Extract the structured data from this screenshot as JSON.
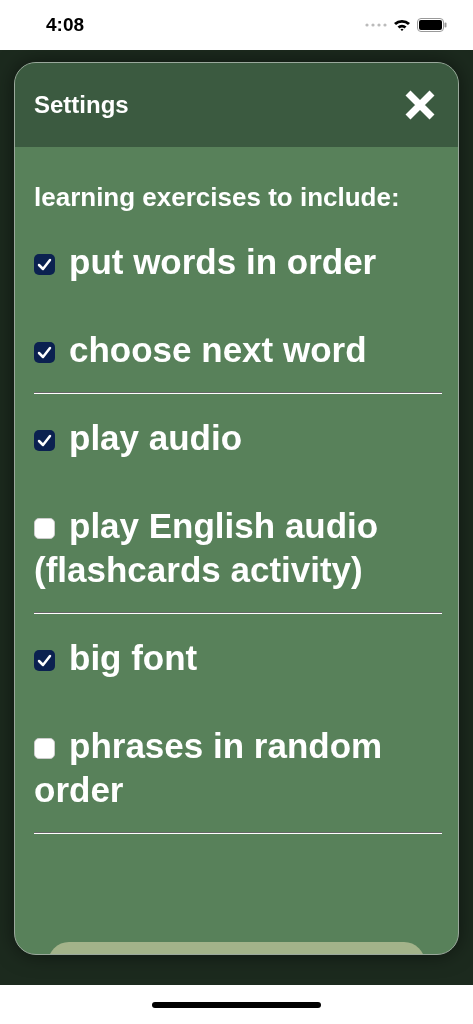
{
  "status_bar": {
    "time": "4:08"
  },
  "dialog": {
    "title": "Settings",
    "heading": "learning exercises to include:",
    "groups": [
      {
        "options": [
          {
            "label": "put words in order",
            "checked": true
          },
          {
            "label": "choose next word",
            "checked": true
          }
        ]
      },
      {
        "options": [
          {
            "label": "play audio",
            "checked": true
          },
          {
            "label": "play English audio (flashcards activity)",
            "checked": false
          }
        ]
      },
      {
        "options": [
          {
            "label": "big font",
            "checked": true
          },
          {
            "label": "phrases in random order",
            "checked": false
          }
        ]
      }
    ]
  }
}
